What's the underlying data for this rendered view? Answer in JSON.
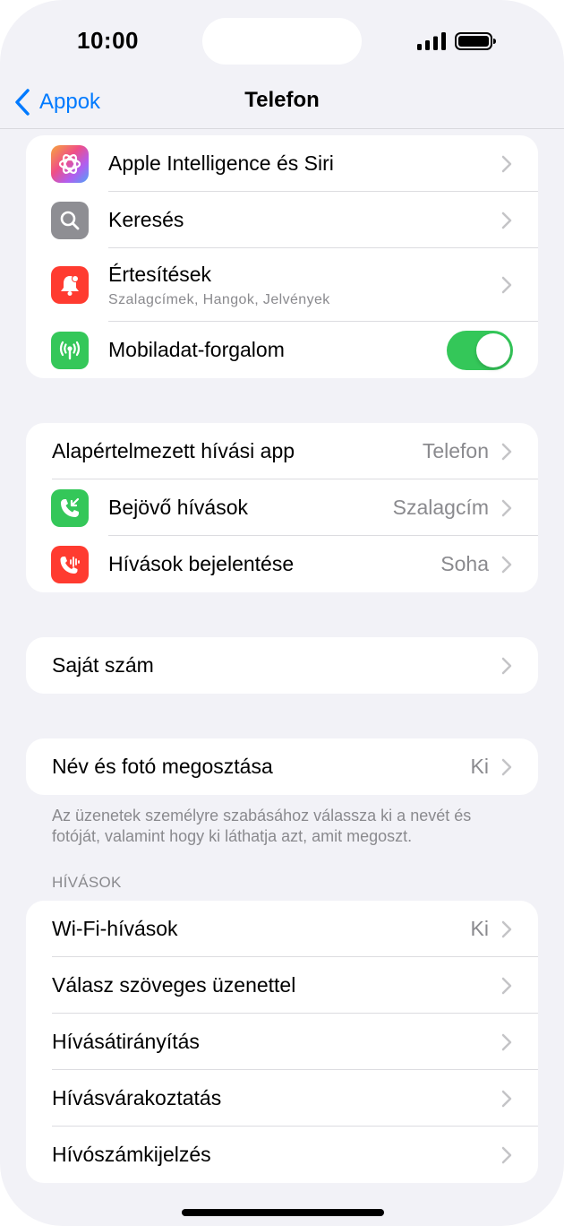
{
  "status_bar": {
    "time": "10:00"
  },
  "nav": {
    "back_label": "Appok",
    "title": "Telefon"
  },
  "group1": [
    {
      "label": "Apple Intelligence és Siri",
      "icon": "apple-intelligence-icon"
    },
    {
      "label": "Keresés",
      "icon": "search-icon"
    },
    {
      "label": "Értesítések",
      "sublabel": "Szalagcímek, Hangok, Jelvények",
      "icon": "notifications-icon"
    },
    {
      "label": "Mobiladat-forgalom",
      "icon": "cellular-icon",
      "toggle_on": true
    }
  ],
  "group2": [
    {
      "label": "Alapértelmezett hívási app",
      "value": "Telefon"
    },
    {
      "label": "Bejövő hívások",
      "value": "Szalagcím",
      "icon": "incoming-call-icon"
    },
    {
      "label": "Hívások bejelentése",
      "value": "Soha",
      "icon": "announce-calls-icon"
    }
  ],
  "group3": [
    {
      "label": "Saját szám"
    }
  ],
  "group4": [
    {
      "label": "Név és fotó megosztása",
      "value": "Ki"
    }
  ],
  "group4_footer": "Az üzenetek személyre szabásához válassza ki a nevét és fotóját, valamint hogy ki láthatja azt, amit megoszt.",
  "calls_header": "HÍVÁSOK",
  "group5": [
    {
      "label": "Wi-Fi-hívások",
      "value": "Ki"
    },
    {
      "label": "Válasz szöveges üzenettel"
    },
    {
      "label": "Hívásátirányítás"
    },
    {
      "label": "Hívásvárakoztatás"
    },
    {
      "label": "Hívószámkijelzés"
    }
  ],
  "colors": {
    "accent": "#007aff",
    "toggle_on": "#34c759",
    "background": "#f2f2f7",
    "secondary_text": "#8a8a8e"
  }
}
